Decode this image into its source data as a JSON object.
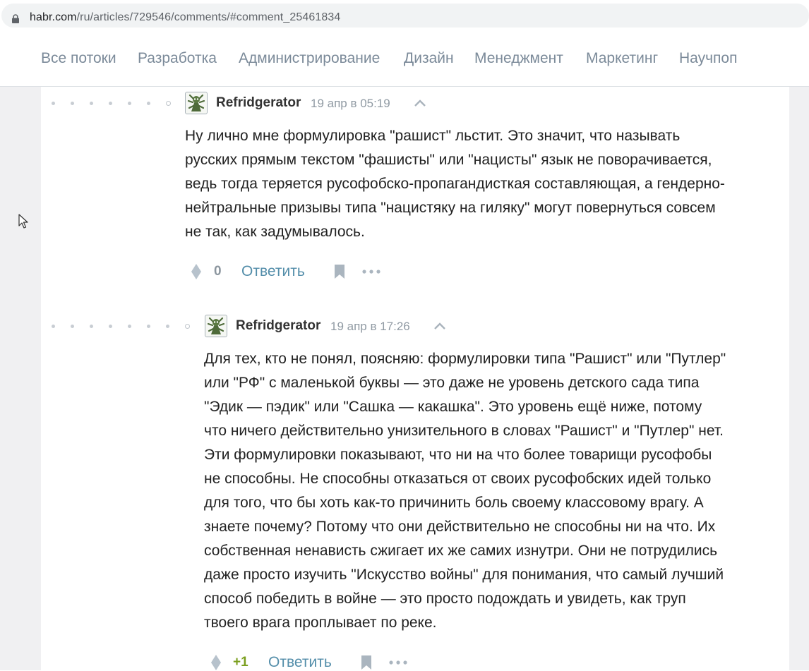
{
  "browser": {
    "url_host": "habr.com",
    "url_path": "/ru/articles/729546/comments/#comment_25461834"
  },
  "nav": {
    "items": [
      "Все потоки",
      "Разработка",
      "Администрирование",
      "Дизайн",
      "Менеджмент",
      "Маркетинг",
      "Научпоп"
    ]
  },
  "comments": [
    {
      "author": "Refridgerator",
      "time": "19 апр в 05:19",
      "lines": [
        "Ну лично мне формулировка \"рашист\" льстит. Это значит, что называть",
        "русских прямым текстом \"фашисты\" или \"нацисты\" язык не поворачивается,",
        "ведь тогда теряется русофобско-пропагандисткая составляющая, а гендерно-",
        "нейтральные призывы типа \"нацистяку на гиляку\" могут повернуться совсем",
        "не так, как задумывалось."
      ],
      "score": "0",
      "score_color": "#8c969f",
      "reply_label": "Ответить"
    },
    {
      "author": "Refridgerator",
      "time": "19 апр в 17:26",
      "lines": [
        "Для тех, кто не понял, поясняю: формулировки типа \"Рашист\" или \"Путлер\"",
        "или \"РФ\" с маленькой буквы — это даже не уровень детского сада типа",
        "\"Эдик — пэдик\" или \"Сашка — какашка\". Это уровень ещё ниже, потому",
        "что ничего действительно унизительного в словах \"Рашист\" и \"Путлер\" нет.",
        "Эти формулировки показывают, что ни на что более товарищи русофобы",
        "не способны. Не способны отказаться от своих русофобских идей только",
        "для того, что бы хоть как-то причинить боль своему классовому врагу. А",
        "знаете почему? Потому что они действительно не способны ни на что. Их",
        "собственная ненависть сжигает их же самих изнутри. Они не потрудились",
        "даже просто изучить \"Искусство войны\" для понимания, что самый лучший",
        "способ победить в войне — это просто подождать и увидеть, как труп",
        "твоего врага проплывает по реке."
      ],
      "score": "+1",
      "score_color": "#7b9f1f",
      "reply_label": "Ответить"
    }
  ]
}
